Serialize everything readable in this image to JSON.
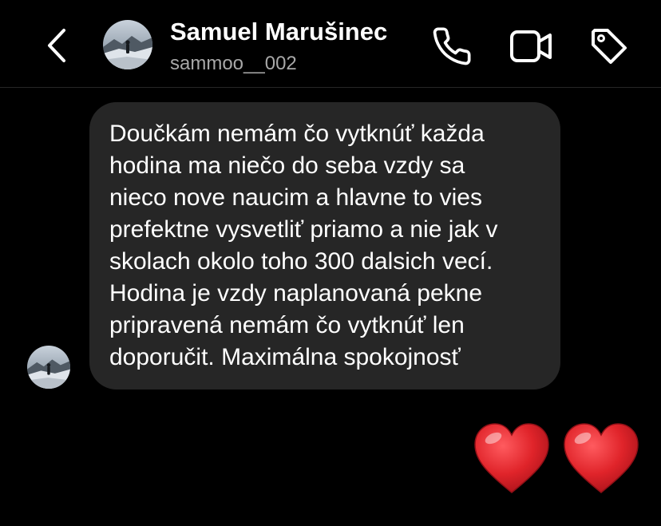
{
  "header": {
    "name": "Samuel Marušinec",
    "username": "sammoo__002",
    "back_icon": "chevron-left-icon",
    "actions": [
      {
        "icon": "phone-icon",
        "label": "Audio call"
      },
      {
        "icon": "video-camera-icon",
        "label": "Video call"
      },
      {
        "icon": "tag-icon",
        "label": "Label"
      }
    ]
  },
  "messages": [
    {
      "sender": "received",
      "text": "Doučkám nemám čo vytknúť každa\nhodina ma niečo do seba vzdy sa\nnieco nove naucim a hlavne to vies\nprefektne vysvetliť priamo a nie jak v\nskolach okolo toho  300 dalsich vecí.\nHodina je vzdy naplanovaná pekne\npripravená nemám čo vytknúť len\ndoporučit. Maximálna spokojnosť"
    },
    {
      "sender": "sent",
      "emoji": "❤️❤️",
      "icons": [
        "red-heart-icon",
        "red-heart-icon"
      ]
    }
  ],
  "colors": {
    "background": "#000000",
    "bubble_received": "#262626",
    "text_primary": "#ffffff",
    "text_secondary": "#a8a8a8",
    "heart": "#e0242a"
  }
}
